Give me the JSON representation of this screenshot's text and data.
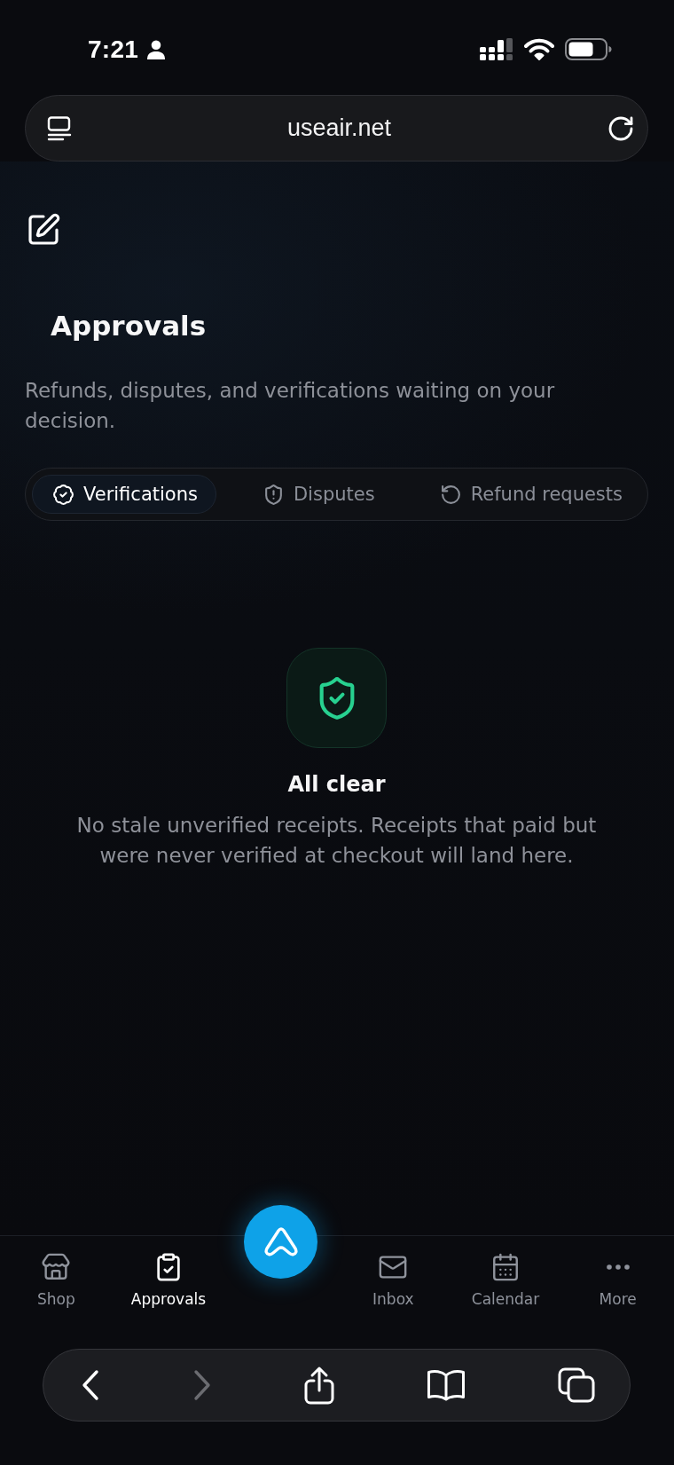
{
  "status_bar": {
    "time": "7:21"
  },
  "address_bar": {
    "url": "useair.net"
  },
  "header": {
    "title": "Approvals",
    "subtitle": "Refunds, disputes, and verifications waiting on your decision."
  },
  "tabs": [
    {
      "label": "Verifications",
      "selected": true
    },
    {
      "label": "Disputes",
      "selected": false
    },
    {
      "label": "Refund requests",
      "selected": false
    }
  ],
  "empty_state": {
    "title": "All clear",
    "message": "No stale unverified receipts. Receipts that paid but were never verified at checkout will land here."
  },
  "bottom_nav": [
    {
      "label": "Shop",
      "selected": false
    },
    {
      "label": "Approvals",
      "selected": true
    },
    {
      "label": "Inbox",
      "selected": false
    },
    {
      "label": "Calendar",
      "selected": false
    },
    {
      "label": "More",
      "selected": false
    }
  ],
  "browser_toolbar": {
    "buttons": [
      {
        "disabled": false
      },
      {
        "disabled": true
      },
      {
        "disabled": false
      },
      {
        "disabled": false
      },
      {
        "disabled": false
      }
    ]
  }
}
